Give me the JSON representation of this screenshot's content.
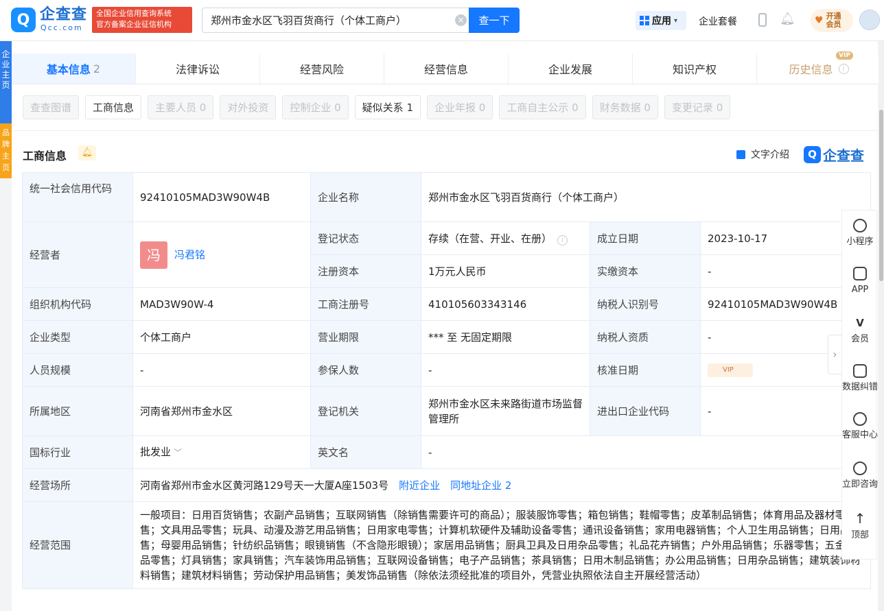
{
  "brand": {
    "logo_glyph": "Q",
    "name": "企查查",
    "domain": "Qcc.com",
    "badge_line1": "全国企业信用查询系统",
    "badge_line2": "官方备案企业征信机构"
  },
  "search": {
    "value": "郑州市金水区飞羽百货商行（个体工商户）",
    "button": "查一下"
  },
  "header": {
    "apps": "应用",
    "suite": "企业套餐",
    "vip_line1": "开通",
    "vip_line2": "会员"
  },
  "side_tabs": {
    "main_chars": "企业主页",
    "brand_chars": "品牌主页"
  },
  "tabs": [
    {
      "label": "基本信息",
      "count": "2"
    },
    {
      "label": "法律诉讼"
    },
    {
      "label": "经营风险"
    },
    {
      "label": "经营信息"
    },
    {
      "label": "企业发展"
    },
    {
      "label": "知识产权"
    },
    {
      "label": "历史信息",
      "tag": "VIP"
    }
  ],
  "subtabs": [
    "查查图谱",
    "工商信息",
    "主要人员 0",
    "对外投资",
    "控制企业 0",
    "疑似关系 1",
    "企业年报 0",
    "工商自主公示 0",
    "财务数据 0",
    "变更记录 0"
  ],
  "section": {
    "title": "工商信息",
    "intro": "文字介绍",
    "brand": "企查查"
  },
  "info": {
    "credit_code_label": "统一社会信用代码",
    "credit_code": "92410105MAD3W90W4B",
    "name_label": "企业名称",
    "name": "郑州市金水区飞羽百货商行（个体工商户）",
    "operator_label": "经营者",
    "operator_avatar": "冯",
    "operator": "冯君铭",
    "status_label": "登记状态",
    "status": "存续（在营、开业、在册）",
    "founded_label": "成立日期",
    "founded": "2023-10-17",
    "capital_label": "注册资本",
    "capital": "1万元人民币",
    "paid_label": "实缴资本",
    "paid": "-",
    "org_code_label": "组织机构代码",
    "org_code": "MAD3W90W-4",
    "reg_no_label": "工商注册号",
    "reg_no": "410105603343146",
    "tax_id_label": "纳税人识别号",
    "tax_id": "92410105MAD3W90W4B",
    "type_label": "企业类型",
    "type": "个体工商户",
    "term_label": "营业期限",
    "term": "*** 至 无固定期限",
    "tax_qual_label": "纳税人资质",
    "tax_qual": "-",
    "staff_label": "人员规模",
    "staff": "-",
    "insured_label": "参保人数",
    "insured": "-",
    "approve_label": "核准日期",
    "approve_lock": "VIP",
    "region_label": "所属地区",
    "region": "河南省郑州市金水区",
    "authority_label": "登记机关",
    "authority": "郑州市金水区未来路街道市场监督管理所",
    "ie_code_label": "进出口企业代码",
    "ie_code": "-",
    "industry_label": "国标行业",
    "industry": "批发业",
    "en_name_label": "英文名",
    "en_name": "-",
    "address_label": "经营场所",
    "address": "河南省郑州市金水区黄河路129号天一大厦A座1503号",
    "nearby": "附近企业",
    "same_addr": "同地址企业 2",
    "scope_label": "经营范围",
    "scope": "一般项目：日用百货销售；农副产品销售；互联网销售（除销售需要许可的商品）；服装服饰零售；箱包销售；鞋帽零售；皮革制品销售；体育用品及器材零售；文具用品零售；玩具、动漫及游艺用品销售；日用家电零售；计算机软硬件及辅助设备零售；通讯设备销售；家用电器销售；个人卫生用品销售；日用品销售；母婴用品销售；针纺织品销售；眼镜销售（不含隐形眼镜）；家居用品销售；厨具卫具及日用杂品零售；礼品花卉销售；户外用品销售；乐器零售；五金产品零售；灯具销售；家具销售；汽车装饰用品销售；互联网设备销售；电子产品销售；茶具销售；日用木制品销售；办公用品销售；日用杂品销售；建筑装饰材料销售；建筑材料销售；劳动保护用品销售；美发饰品销售（除依法须经批准的项目外，凭营业执照依法自主开展经营活动）"
  },
  "right_panel": [
    {
      "label": "小程序",
      "icon": "link-icon"
    },
    {
      "label": "APP",
      "icon": "phone-icon"
    },
    {
      "label": "会员",
      "icon": "vip-icon"
    },
    {
      "label": "数据纠错",
      "icon": "edit-icon"
    },
    {
      "label": "客服中心",
      "icon": "headset-icon"
    },
    {
      "label": "立即咨询",
      "icon": "chat-icon"
    },
    {
      "label": "顶部",
      "icon": "back-to-top-icon"
    }
  ]
}
